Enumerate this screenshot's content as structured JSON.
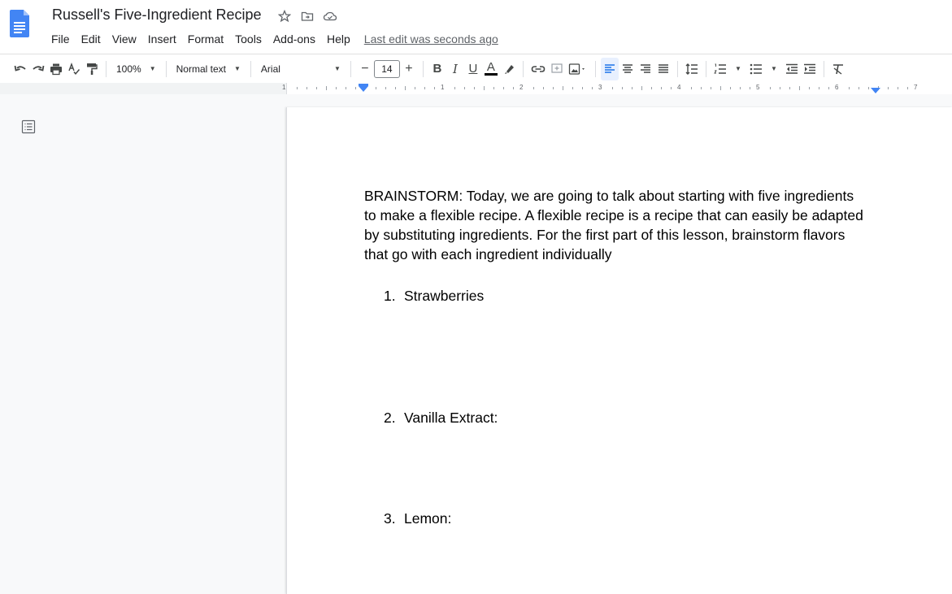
{
  "app": {
    "doc_title": "Russell's Five-Ingredient Recipe",
    "title_icons": [
      "star-icon",
      "move-to-folder-icon",
      "cloud-status-icon"
    ]
  },
  "menu": {
    "items": [
      "File",
      "Edit",
      "View",
      "Insert",
      "Format",
      "Tools",
      "Add-ons",
      "Help"
    ],
    "last_edit": "Last edit was seconds ago"
  },
  "toolbar": {
    "zoom": "100%",
    "style": "Normal text",
    "font": "Arial",
    "font_size": "14",
    "minus": "−",
    "plus": "+",
    "bold": "B",
    "italic": "I",
    "underline": "U",
    "text_color": "A",
    "text_color_value": "#000000",
    "accent": "#1a73e8"
  },
  "ruler": {
    "numbers": [
      "1",
      "1",
      "2",
      "3",
      "4",
      "5",
      "6",
      "7"
    ]
  },
  "document": {
    "paragraph": "BRAINSTORM: Today, we are going to talk about starting with five ingredients to make a flexible recipe. A flexible recipe is a recipe that can easily be adapted by substituting ingredients. For the first part of this lesson, brainstorm flavors that go with each ingredient individually",
    "list": [
      {
        "num": "1.",
        "text": "Strawberries"
      },
      {
        "num": "2.",
        "text": "Vanilla Extract:"
      },
      {
        "num": "3.",
        "text": "Lemon:"
      }
    ]
  }
}
